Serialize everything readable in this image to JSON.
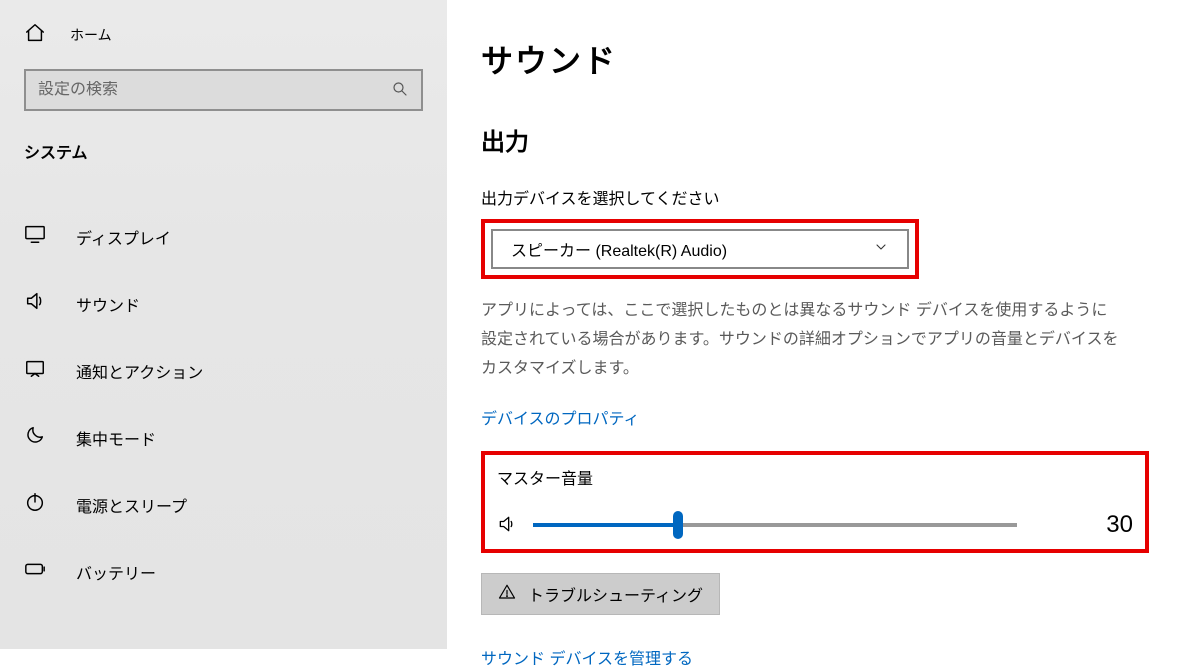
{
  "sidebar": {
    "home_label": "ホーム",
    "search_placeholder": "設定の検索",
    "category_label": "システム",
    "items": [
      {
        "icon": "display-icon",
        "label": "ディスプレイ"
      },
      {
        "icon": "volume-icon",
        "label": "サウンド"
      },
      {
        "icon": "notification-icon",
        "label": "通知とアクション"
      },
      {
        "icon": "focus-icon",
        "label": "集中モード"
      },
      {
        "icon": "power-icon",
        "label": "電源とスリープ"
      },
      {
        "icon": "battery-icon",
        "label": "バッテリー"
      }
    ]
  },
  "main": {
    "page_title": "サウンド",
    "output_section": "出力",
    "output_device_label": "出力デバイスを選択してください",
    "output_device_value": "スピーカー (Realtek(R) Audio)",
    "output_help": "アプリによっては、ここで選択したものとは異なるサウンド デバイスを使用するように設定されている場合があります。サウンドの詳細オプションでアプリの音量とデバイスをカスタマイズします。",
    "device_properties_link": "デバイスのプロパティ",
    "master_volume_label": "マスター音量",
    "master_volume_value": "30",
    "troubleshoot_label": "トラブルシューティング",
    "manage_devices_link": "サウンド デバイスを管理する"
  }
}
